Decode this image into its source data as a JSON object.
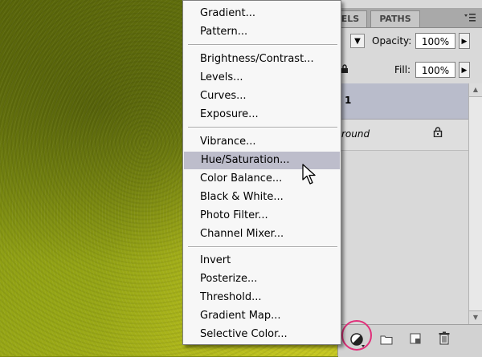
{
  "panel": {
    "tabs": [
      "ELS",
      "PATHS"
    ],
    "opacity_label": "Opacity:",
    "opacity_value": "100%",
    "fill_label": "Fill:",
    "fill_value": "100%",
    "layers": [
      "1",
      "round"
    ]
  },
  "menu": {
    "group1": [
      "Gradient...",
      "Pattern..."
    ],
    "group2": [
      "Brightness/Contrast...",
      "Levels...",
      "Curves...",
      "Exposure..."
    ],
    "group3": [
      "Vibrance...",
      "Hue/Saturation...",
      "Color Balance...",
      "Black & White...",
      "Photo Filter...",
      "Channel Mixer..."
    ],
    "group4": [
      "Invert",
      "Posterize...",
      "Threshold...",
      "Gradient Map...",
      "Selective Color..."
    ],
    "highlighted": "Hue/Saturation..."
  },
  "colors": {
    "canvas": "#8a9413",
    "menu_highlight": "#bdbdcb",
    "selected_layer": "#b9bccb",
    "annotation_circle": "#e0307a"
  },
  "icons": [
    "panel-menu-icon",
    "lock-icon",
    "adjustment-layer-icon",
    "new-group-icon",
    "new-layer-icon",
    "trash-icon",
    "mouse-cursor-icon"
  ]
}
